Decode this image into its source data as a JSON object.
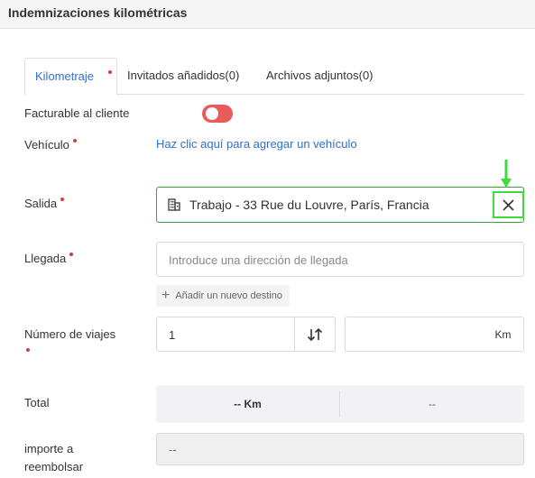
{
  "header": {
    "title": "Indemnizaciones kilométricas"
  },
  "tabs": [
    {
      "label": "Kilometraje",
      "active": true,
      "required": true
    },
    {
      "label": "Invitados añadidos(0)",
      "active": false
    },
    {
      "label": "Archivos adjuntos(0)",
      "active": false
    }
  ],
  "billable": {
    "label": "Facturable al cliente",
    "state": "off"
  },
  "vehicle": {
    "label": "Vehículo",
    "link": "Haz clic aquí para agregar un vehículo"
  },
  "departure": {
    "label": "Salida",
    "value": "Trabajo - 33 Rue du Louvre, París, Francia",
    "clear_symbol": "✕"
  },
  "arrival": {
    "label": "Llegada",
    "placeholder": "Introduce una dirección de llegada"
  },
  "add_destination": {
    "label": "Añadir un nuevo destino",
    "symbol": "+"
  },
  "trips": {
    "label": "Número de viajes",
    "value": "1",
    "distance_value": "",
    "unit": "Km"
  },
  "total": {
    "label": "Total",
    "distance": "-- Km",
    "amount": "--"
  },
  "reimburse": {
    "label_line1": "importe a",
    "label_line2": "reembolsar",
    "value": "--"
  },
  "colors": {
    "accent": "#2f6fce",
    "required": "#d93b3b",
    "toggle_off": "#e85b5b",
    "highlight": "#3ddc3d",
    "selected_border": "#3aa43a"
  },
  "icons": {
    "departure": "building-icon",
    "swap": "swap-arrows-icon",
    "annotation": "arrow-down-icon"
  }
}
